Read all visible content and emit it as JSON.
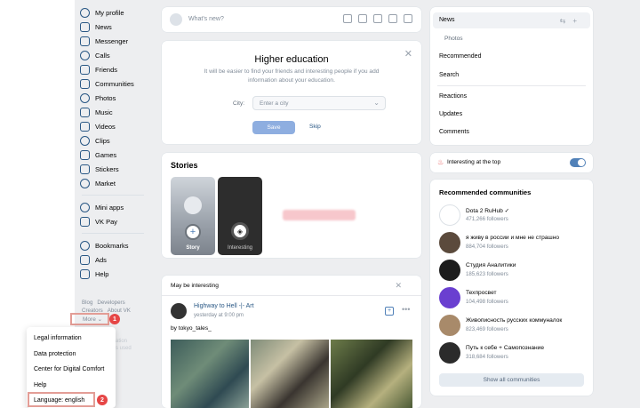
{
  "sidebar": {
    "items": [
      {
        "label": "My profile",
        "icon": "profile-icon"
      },
      {
        "label": "News",
        "icon": "news-icon"
      },
      {
        "label": "Messenger",
        "icon": "messenger-icon"
      },
      {
        "label": "Calls",
        "icon": "phone-icon"
      },
      {
        "label": "Friends",
        "icon": "friends-icon"
      },
      {
        "label": "Communities",
        "icon": "communities-icon"
      },
      {
        "label": "Photos",
        "icon": "photos-icon"
      },
      {
        "label": "Music",
        "icon": "music-icon"
      },
      {
        "label": "Videos",
        "icon": "videos-icon"
      },
      {
        "label": "Clips",
        "icon": "clips-icon"
      },
      {
        "label": "Games",
        "icon": "games-icon"
      },
      {
        "label": "Stickers",
        "icon": "stickers-icon"
      },
      {
        "label": "Market",
        "icon": "market-icon"
      }
    ],
    "items2": [
      {
        "label": "Mini apps",
        "icon": "mini-apps-icon"
      },
      {
        "label": "VK Pay",
        "icon": "vk-pay-icon"
      }
    ],
    "items3": [
      {
        "label": "Bookmarks",
        "icon": "bookmark-icon"
      },
      {
        "label": "Ads",
        "icon": "ads-icon"
      },
      {
        "label": "Help",
        "icon": "help-icon"
      }
    ],
    "footer": {
      "blog": "Blog",
      "developers": "Developers",
      "creators": "Creators",
      "about": "About VK",
      "more": "More"
    },
    "badge1": "1",
    "badge2": "2",
    "faded1": "ation",
    "faded2": "s used"
  },
  "more_menu": {
    "items": [
      "Legal information",
      "Data protection",
      "Center for Digital Comfort",
      "Help",
      "Language: english"
    ]
  },
  "post_box": {
    "placeholder": "What's new?"
  },
  "education": {
    "title": "Higher education",
    "text": "It will be easier to find your friends and interesting people if you add information about your education.",
    "city_label": "City:",
    "city_placeholder": "Enter a city",
    "save": "Save",
    "skip": "Skip"
  },
  "stories": {
    "title": "Stories",
    "story1": "Story",
    "story2": "Interesting"
  },
  "feed": {
    "header": "May be interesting",
    "author": "Highway to Hell -|- Art",
    "time": "yesterday at 9:00 pm",
    "text": "by tokyo_tales_"
  },
  "right_menu": {
    "news": "News",
    "photos": "Photos",
    "recommended": "Recommended",
    "search": "Search",
    "reactions": "Reactions",
    "updates": "Updates",
    "comments": "Comments"
  },
  "interesting": {
    "label": "Interesting at the top"
  },
  "recommended": {
    "title": "Recommended communities",
    "items": [
      {
        "name": "Dota 2 RuHub ✓",
        "followers": "471,266 followers",
        "color": "#ffffff"
      },
      {
        "name": "я живу в россии и мне не страшно",
        "followers": "884,704 followers",
        "color": "#5b4a3c"
      },
      {
        "name": "Студия Аналитики",
        "followers": "185,623 followers",
        "color": "#1c1c1c"
      },
      {
        "name": "Техпросвет",
        "followers": "104,498 followers",
        "color": "#6a3fd0"
      },
      {
        "name": "Живописность русских коммуналок",
        "followers": "823,469 followers",
        "color": "#a88a6a"
      },
      {
        "name": "Путь к себе + Самопознание",
        "followers": "318,684 followers",
        "color": "#2b2b2b"
      }
    ],
    "show_all": "Show all communities"
  }
}
